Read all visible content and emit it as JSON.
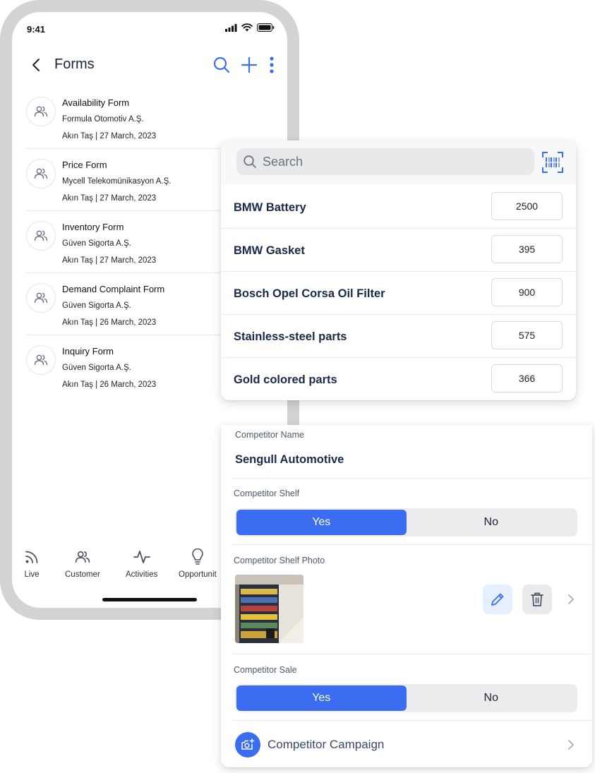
{
  "status_bar": {
    "time": "9:41"
  },
  "header": {
    "title": "Forms"
  },
  "forms": [
    {
      "title": "Availability Form",
      "company": "Formula Otomotiv A.Ş.",
      "meta": "Akın Taş | 27 March, 2023"
    },
    {
      "title": "Price Form",
      "company": "Mycell Telekomünikasyon A.Ş.",
      "meta": "Akın Taş | 27 March, 2023"
    },
    {
      "title": "Inventory Form",
      "company": "Güven Sigorta A.Ş.",
      "meta": "Akın Taş | 27 March, 2023"
    },
    {
      "title": "Demand Complaint Form",
      "company": "Güven Sigorta A.Ş.",
      "meta": "Akın Taş | 26 March, 2023"
    },
    {
      "title": "Inquiry Form",
      "company": "Güven Sigorta A.Ş.",
      "meta": "Akın Taş | 26 March, 2023"
    }
  ],
  "tabs": [
    {
      "label": "Live",
      "icon": "rss-icon"
    },
    {
      "label": "Customer",
      "icon": "users-icon"
    },
    {
      "label": "Activities",
      "icon": "activity-icon"
    },
    {
      "label": "Opportunit",
      "icon": "lightbulb-icon"
    }
  ],
  "product_search": {
    "placeholder": "Search"
  },
  "products": [
    {
      "name": "BMW Battery",
      "qty": "2500"
    },
    {
      "name": "BMW Gasket",
      "qty": "395"
    },
    {
      "name": "Bosch Opel Corsa Oil Filter",
      "qty": "900"
    },
    {
      "name": "Stainless-steel parts",
      "qty": "575"
    },
    {
      "name": "Gold colored parts",
      "qty": "366"
    }
  ],
  "competitor": {
    "name_label": "Competitor Name",
    "name_value": "Sengull Automotive",
    "shelf_label": "Competitor Shelf",
    "shelf_yes": "Yes",
    "shelf_no": "No",
    "photo_label": "Competitor Shelf Photo",
    "sale_label": "Competitor Sale",
    "sale_yes": "Yes",
    "sale_no": "No",
    "campaign_label": "Competitor Campaign"
  },
  "colors": {
    "accent": "#3b6df2",
    "accent_light": "#e6efff",
    "icon_blue": "#3b6df2"
  }
}
